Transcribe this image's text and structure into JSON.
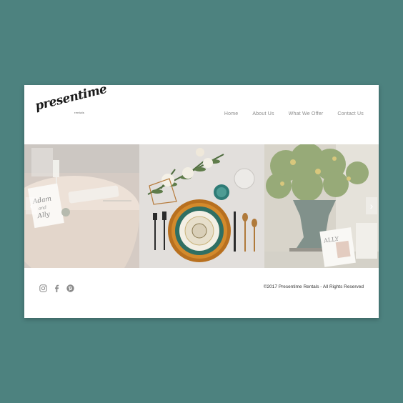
{
  "colors": {
    "page_background": "#4d827f",
    "site_background": "#ffffff",
    "nav_text": "#8a8a8a",
    "footer_text": "#333333"
  },
  "logo": {
    "script": "presentime",
    "sub": "rentals"
  },
  "nav": {
    "items": [
      {
        "label": "Home"
      },
      {
        "label": "About Us"
      },
      {
        "label": "What We Offer"
      },
      {
        "label": "Contact Us"
      }
    ]
  },
  "gallery": {
    "panel1_card_text": "Adam and Ally",
    "panel3_card_text": "ALLY",
    "arrow_left": "‹",
    "arrow_right": "›"
  },
  "footer": {
    "social_icons": [
      "instagram-icon",
      "facebook-icon",
      "pinterest-icon"
    ],
    "copyright": "©2017 Presentime Rentals - All Rights Reserved"
  }
}
